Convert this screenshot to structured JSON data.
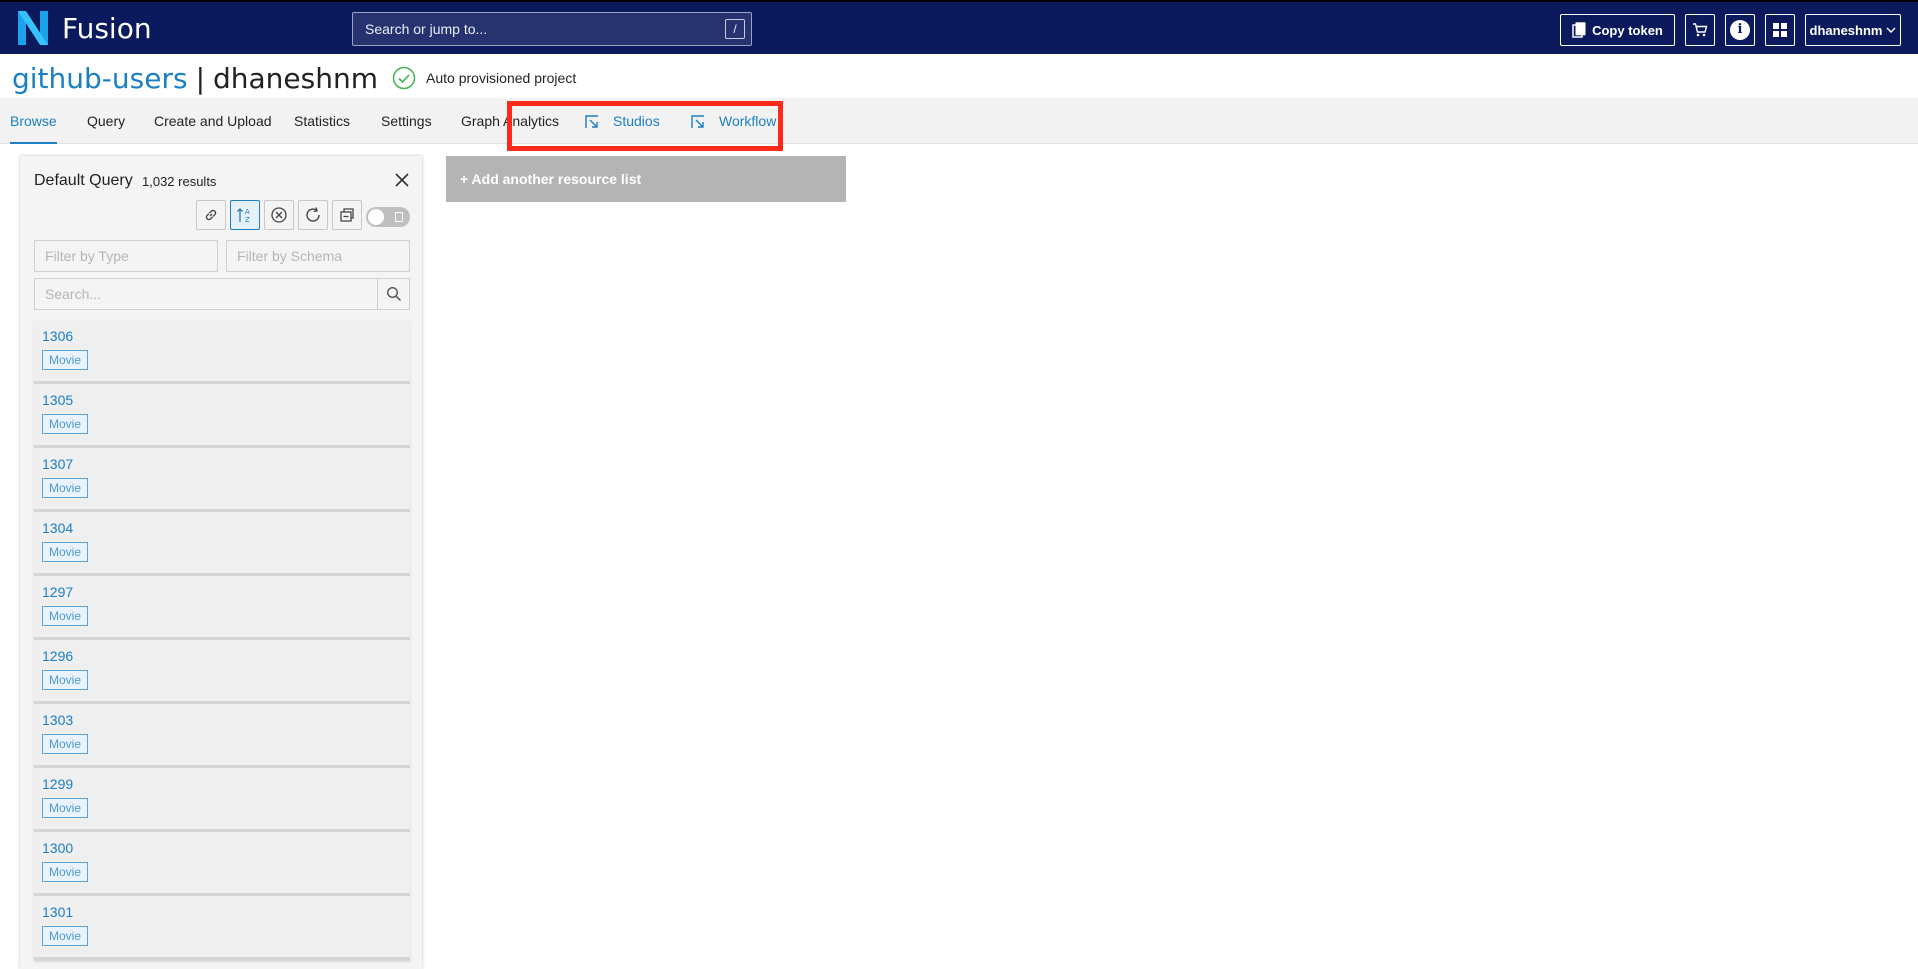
{
  "app": {
    "title": "Fusion"
  },
  "topbar": {
    "search_placeholder": "Search or jump to...",
    "search_shortcut": "/",
    "copy_token_label": "Copy token",
    "user_label": "dhaneshnm"
  },
  "project": {
    "org": "github-users",
    "separator": "|",
    "name": "dhaneshnm",
    "description": "Auto provisioned project"
  },
  "tabs": [
    {
      "label": "Browse",
      "active": true
    },
    {
      "label": "Query"
    },
    {
      "label": "Create and Upload"
    },
    {
      "label": "Statistics"
    },
    {
      "label": "Settings"
    },
    {
      "label": "Graph Analytics"
    },
    {
      "label": "Studios",
      "external": true
    },
    {
      "label": "Workflow",
      "external": true
    }
  ],
  "panel": {
    "title": "Default Query",
    "count": "1,032 results",
    "filter_type_placeholder": "Filter by Type",
    "filter_schema_placeholder": "Filter by Schema",
    "search_placeholder": "Search..."
  },
  "results": [
    {
      "id": "1306",
      "type": "Movie"
    },
    {
      "id": "1305",
      "type": "Movie"
    },
    {
      "id": "1307",
      "type": "Movie"
    },
    {
      "id": "1304",
      "type": "Movie"
    },
    {
      "id": "1297",
      "type": "Movie"
    },
    {
      "id": "1296",
      "type": "Movie"
    },
    {
      "id": "1303",
      "type": "Movie"
    },
    {
      "id": "1299",
      "type": "Movie"
    },
    {
      "id": "1300",
      "type": "Movie"
    },
    {
      "id": "1301",
      "type": "Movie"
    }
  ],
  "main": {
    "add_list_label": "+ Add another resource list"
  },
  "colors": {
    "topbar": "#0b1a5c",
    "accent": "#1b7fc4",
    "highlight": "#ff2a1a"
  }
}
